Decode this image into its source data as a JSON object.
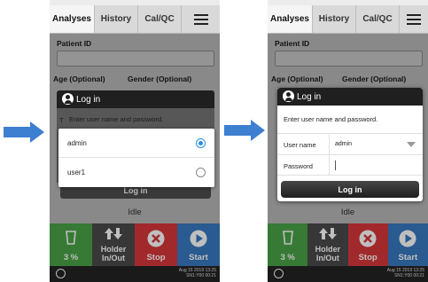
{
  "tabs": [
    "Analyses",
    "History",
    "Cal/QC"
  ],
  "menu_icon": "hamburger-menu-icon",
  "patient_id_label": "Patient ID",
  "age_label": "Age (Optional)",
  "gender_label": "Gender (Optional)",
  "login_title": "Log in",
  "login_prompt": "Enter user name and password.",
  "dropdown_options": [
    "admin",
    "user1"
  ],
  "selected_option": "admin",
  "user_name_label": "User name",
  "user_name_value": "admin",
  "password_label": "Password",
  "login_button": "Log in",
  "status_text": "Idle",
  "bottom_buttons": {
    "percent": "3 %",
    "holder_line1": "Holder",
    "holder_line2": "In/Out",
    "stop": "Stop",
    "start": "Start"
  },
  "partial_letter": "T",
  "statusbar_time": "Aug 15 2019 13:25",
  "statusbar_sub": "SN1:Y00 00:21",
  "colors": {
    "green": "#4aa347",
    "red": "#d8373a",
    "blue": "#3778c0",
    "radio_blue": "#2a8fe0",
    "arrow_blue": "#3d7fd0"
  }
}
